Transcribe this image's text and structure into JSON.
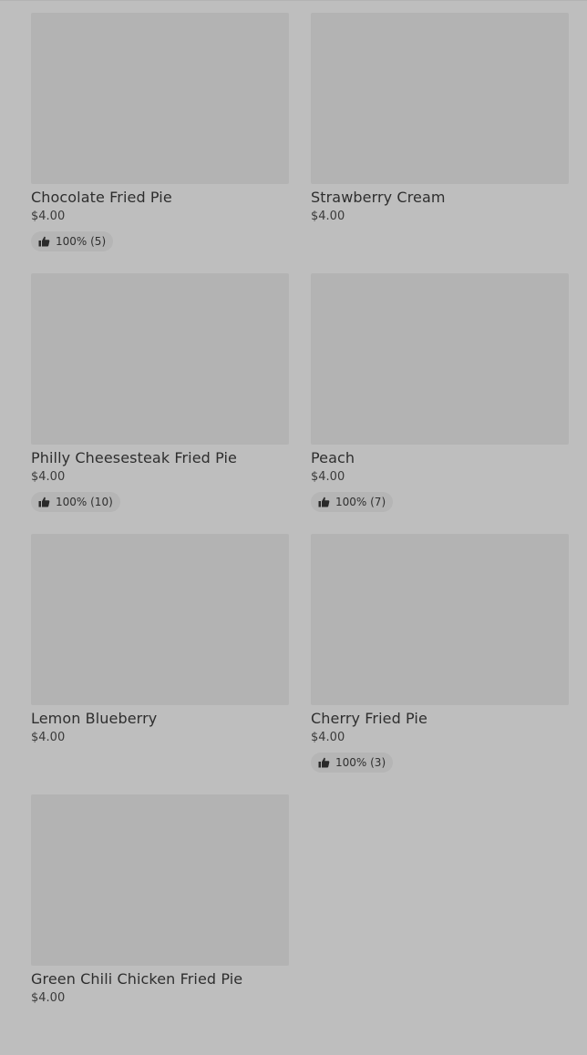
{
  "items": [
    {
      "name": "Chocolate Fried Pie",
      "price": "$4.00",
      "rating": "100% (5)",
      "has_rating": true
    },
    {
      "name": "Strawberry Cream",
      "price": "$4.00",
      "rating": "",
      "has_rating": false
    },
    {
      "name": "Philly Cheesesteak Fried Pie",
      "price": "$4.00",
      "rating": "100% (10)",
      "has_rating": true
    },
    {
      "name": "Peach",
      "price": "$4.00",
      "rating": "100% (7)",
      "has_rating": true
    },
    {
      "name": "Lemon Blueberry",
      "price": "$4.00",
      "rating": "",
      "has_rating": false
    },
    {
      "name": "Cherry Fried Pie",
      "price": "$4.00",
      "rating": "100% (3)",
      "has_rating": true
    },
    {
      "name": "Green Chili Chicken Fried Pie",
      "price": "$4.00",
      "rating": "",
      "has_rating": false
    }
  ],
  "icons": {
    "rating_icon": "thumbs-up-icon"
  },
  "colors": {
    "background": "#bebebe",
    "thumbnail": "#b3b3b3",
    "rating_pill": "#b5b5b5",
    "text": "#2e2e2e"
  }
}
